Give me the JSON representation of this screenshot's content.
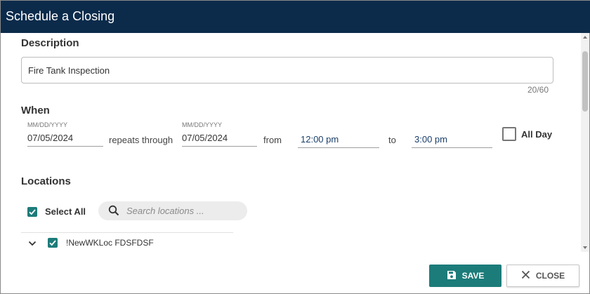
{
  "dialog": {
    "title": "Schedule a Closing"
  },
  "description": {
    "section_label": "Description",
    "value": "Fire Tank Inspection",
    "counter": "20/60"
  },
  "when": {
    "section_label": "When",
    "start_date": {
      "format_hint": "MM/DD/YYYY",
      "value": "07/05/2024"
    },
    "repeats_label": "repeats through",
    "end_date": {
      "format_hint": "MM/DD/YYYY",
      "value": "07/05/2024"
    },
    "from_label": "from",
    "from_time": "12:00 pm",
    "to_label": "to",
    "to_time": "3:00 pm",
    "all_day": {
      "label": "All Day",
      "checked": false
    }
  },
  "locations": {
    "section_label": "Locations",
    "select_all": {
      "label": "Select All",
      "checked": true
    },
    "search": {
      "placeholder": "Search locations ...",
      "icon": "search-icon"
    },
    "items": [
      {
        "label": "!NewWKLoc FDSFDSF",
        "checked": true,
        "expanded": false
      }
    ]
  },
  "footer": {
    "save_label": "SAVE",
    "close_label": "CLOSE"
  },
  "colors": {
    "titlebar": "#0c2b4b",
    "accent": "#1c7c7a"
  }
}
